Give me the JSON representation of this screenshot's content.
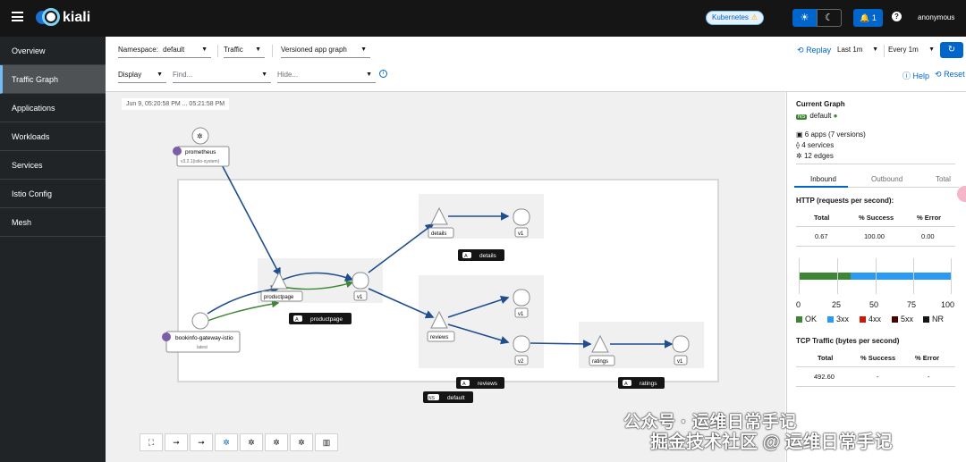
{
  "header": {
    "brand": "kiali",
    "cluster_label": "Kubernetes",
    "notifications_count": "1",
    "user": "anonymous"
  },
  "sidebar": {
    "items": [
      {
        "label": "Overview"
      },
      {
        "label": "Traffic Graph",
        "active": true
      },
      {
        "label": "Applications"
      },
      {
        "label": "Workloads"
      },
      {
        "label": "Services"
      },
      {
        "label": "Istio Config"
      },
      {
        "label": "Mesh"
      }
    ]
  },
  "toolbar": {
    "namespace_label": "Namespace:",
    "namespace_value": "default",
    "traffic_label": "Traffic",
    "graph_type": "Versioned app graph",
    "replay_label": "Replay",
    "duration": "Last 1m",
    "refresh": "Every 1m",
    "display_label": "Display",
    "find_placeholder": "Find...",
    "hide_placeholder": "Hide...",
    "help_label": "Help",
    "reset_label": "Reset"
  },
  "graph": {
    "timestamp": "Jun 9, 05:20:58 PM ... 05:21:58 PM",
    "nodes": {
      "prometheus": "prometheus",
      "prometheus_sub": "v3.2.1(istio-system)",
      "gateway": "bookinfo-gateway-istio",
      "gateway_sub": "latest",
      "productpage": "productpage",
      "productpage_v": "v1",
      "details": "details",
      "details_v": "v1",
      "reviews": "reviews",
      "reviews_v1": "v1",
      "reviews_v2": "v2",
      "ratings": "ratings",
      "ratings_v": "v1"
    },
    "boxes": {
      "productpage": "productpage",
      "details": "details",
      "reviews": "reviews",
      "ratings": "ratings",
      "namespace": "default",
      "app_badge": "A",
      "ns_badge": "NS"
    }
  },
  "panel": {
    "title": "Current Graph",
    "namespace_badge": "NS",
    "namespace": "default",
    "apps": "6 apps (7 versions)",
    "services": "4 services",
    "edges": "12 edges",
    "tabs": [
      "Inbound",
      "Outbound",
      "Total"
    ],
    "http_title": "HTTP (requests per second):",
    "http_headers": [
      "Total",
      "% Success",
      "% Error"
    ],
    "http_values": [
      "0.67",
      "100.00",
      "0.00"
    ],
    "axis_ticks": [
      "0",
      "25",
      "50",
      "75",
      "100"
    ],
    "legend": [
      {
        "label": "OK",
        "color": "#3e8635"
      },
      {
        "label": "3xx",
        "color": "#2b9af3"
      },
      {
        "label": "4xx",
        "color": "#c9190b"
      },
      {
        "label": "5xx",
        "color": "#470000"
      },
      {
        "label": "NR",
        "color": "#151515"
      }
    ],
    "tcp_title": "TCP Traffic (bytes per second)",
    "tcp_headers": [
      "Total",
      "% Success",
      "% Error"
    ],
    "tcp_values": [
      "492.60",
      "-",
      "-"
    ]
  },
  "watermark": {
    "line1": "公众号 · 运维日常手记",
    "line2": "掘金技术社区 @ 运维日常手记"
  }
}
